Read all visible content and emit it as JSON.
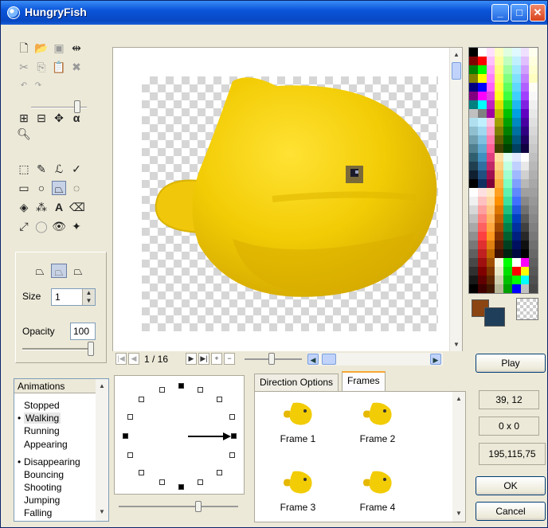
{
  "window": {
    "title": "HungryFish",
    "minimize_glyph": "_",
    "maximize_glyph": "□",
    "close_glyph": "✕"
  },
  "tools": {
    "icons": [
      "new-file-icon",
      "open-folder-icon",
      "save-icon",
      "resize-icon",
      "cut-icon",
      "copy-icon",
      "paste-icon",
      "delete-icon",
      "undo-icon",
      "redo-icon",
      "grid-icon",
      "frame-grid-icon",
      "move-icon",
      "alpha-icon",
      "zoom-icon",
      "select-rect-icon",
      "pencil-icon",
      "brush-icon",
      "picker-icon",
      "rectangle-icon",
      "ellipse-icon",
      "polygon-icon",
      "lasso-icon",
      "fill-icon",
      "spray-icon",
      "text-icon",
      "eraser-icon",
      "line-icon",
      "circle-select-icon",
      "eye-icon",
      "move-arrow-icon"
    ]
  },
  "options": {
    "size_label": "Size",
    "size_value": "1",
    "opacity_label": "Opacity",
    "opacity_value": "100"
  },
  "frame_nav": {
    "counter": "1 / 16"
  },
  "palette": {
    "columns": [
      [
        "#000000",
        "#800000",
        "#008000",
        "#808000",
        "#000080",
        "#800080",
        "#008080",
        "#c0c0c0",
        "#b0e0f0",
        "#90c0d0",
        "#70a0b0",
        "#508090",
        "#306070",
        "#204050",
        "#102030",
        "#000000",
        "#ffffff",
        "#f0f0f0",
        "#d8d8d8",
        "#c0c0c0",
        "#a8a8a8",
        "#909090",
        "#787878",
        "#606060",
        "#484848",
        "#303030",
        "#181818",
        "#000000"
      ],
      [
        "#ffffff",
        "#ff0000",
        "#00ff00",
        "#ffff00",
        "#0000ff",
        "#ff00ff",
        "#00ffff",
        "#808080",
        "#c0f0ff",
        "#a0d8f0",
        "#80c0e0",
        "#60a8d0",
        "#4090c0",
        "#3070a0",
        "#205080",
        "#103060",
        "#ffe0e0",
        "#ffc0c0",
        "#ffa0a0",
        "#ff8080",
        "#ff6060",
        "#ff4040",
        "#e03030",
        "#c02020",
        "#a01010",
        "#800000",
        "#600000",
        "#400000"
      ],
      [
        "#ffe0ff",
        "#ffc0ff",
        "#ffa0ff",
        "#ff80ff",
        "#ff60ff",
        "#e040e0",
        "#c020c0",
        "#a000a0",
        "#ffc0e0",
        "#ffa0c8",
        "#ff80b0",
        "#ff6098",
        "#e04080",
        "#c02868",
        "#a01050",
        "#800038",
        "#ffe8c0",
        "#ffd8a0",
        "#ffc880",
        "#ffb860",
        "#ffa840",
        "#ff9820",
        "#e08010",
        "#c06800",
        "#a05000",
        "#803800",
        "#602800",
        "#401800"
      ],
      [
        "#ffffc0",
        "#ffffa0",
        "#ffff80",
        "#ffff60",
        "#ffff40",
        "#ffff20",
        "#e0e000",
        "#c0c000",
        "#a0a000",
        "#808000",
        "#606000",
        "#404000",
        "#ffe0a0",
        "#ffd080",
        "#ffc060",
        "#ffb040",
        "#ffa020",
        "#ff9000",
        "#e07800",
        "#c06000",
        "#a04800",
        "#803000",
        "#602000",
        "#401000",
        "#f8f8e0",
        "#e8e8c8",
        "#d0d0b0",
        "#b8b898"
      ],
      [
        "#e0ffe0",
        "#c0ffc0",
        "#a0ffa0",
        "#80ff80",
        "#60ff60",
        "#40ff40",
        "#20e020",
        "#00c000",
        "#00a000",
        "#008000",
        "#006000",
        "#004000",
        "#e0fff0",
        "#c0ffe0",
        "#a0ffd0",
        "#80ffc0",
        "#60f0b0",
        "#40e0a0",
        "#20c080",
        "#00a060",
        "#008048",
        "#006030",
        "#004020",
        "#002010",
        "#00ff00",
        "#00e000",
        "#00c000",
        "#00a000"
      ],
      [
        "#e0f8ff",
        "#c0f0ff",
        "#a0e8ff",
        "#80e0ff",
        "#60d8ff",
        "#40d0ff",
        "#20b8f0",
        "#00a0e0",
        "#0088c0",
        "#0070a0",
        "#005880",
        "#004060",
        "#e0e8ff",
        "#c0d0ff",
        "#a0b8ff",
        "#80a0ff",
        "#6088ff",
        "#4070ff",
        "#2058e0",
        "#0040c0",
        "#0030a0",
        "#002080",
        "#001060",
        "#000840",
        "#ffffff",
        "#ff0000",
        "#00ff00",
        "#0000ff"
      ],
      [
        "#f0e0ff",
        "#e0c0ff",
        "#d0a0ff",
        "#c080ff",
        "#b060ff",
        "#a040ff",
        "#8020e0",
        "#6000c0",
        "#4800a0",
        "#300080",
        "#200060",
        "#100040",
        "#ffffff",
        "#e8e8e8",
        "#d0d0d0",
        "#b8b8b8",
        "#a0a0a0",
        "#888888",
        "#707070",
        "#585858",
        "#404040",
        "#282828",
        "#101010",
        "#000000",
        "#ff00ff",
        "#ffff00",
        "#00ffff",
        "#c0c0c0"
      ],
      [
        "#fffff0",
        "#ffffe0",
        "#ffffd0",
        "#ffffc0",
        "#fffff8",
        "#f8f8f8",
        "#f0f0f0",
        "#e8e8e8",
        "#e0e0e0",
        "#d8d8d8",
        "#d0d0d0",
        "#c8c8c8",
        "#c0c0c0",
        "#b8b8b8",
        "#b0b0b0",
        "#a8a8a8",
        "#a0a0a0",
        "#989898",
        "#909090",
        "#888888",
        "#808080",
        "#787878",
        "#707070",
        "#686868",
        "#606060",
        "#585858",
        "#505050",
        "#484848"
      ]
    ],
    "fg_color": "#8b4513",
    "bg_color": "#1f3e5a"
  },
  "buttons": {
    "play": "Play",
    "ok": "OK",
    "cancel": "Cancel"
  },
  "status": {
    "coords": "39, 12",
    "selection": "0 x 0",
    "color": "195,115,75"
  },
  "animations": {
    "header": "Animations",
    "items": [
      {
        "label": "Stopped",
        "bullet": ""
      },
      {
        "label": "Walking",
        "bullet": "•",
        "selected": true
      },
      {
        "label": "Running",
        "bullet": ""
      },
      {
        "label": "Appearing",
        "bullet": ""
      },
      {
        "label": "Disappearing",
        "bullet": "•"
      },
      {
        "label": "Bouncing",
        "bullet": ""
      },
      {
        "label": "Shooting",
        "bullet": ""
      },
      {
        "label": "Jumping",
        "bullet": ""
      },
      {
        "label": "Falling",
        "bullet": ""
      }
    ]
  },
  "tabs": {
    "direction": "Direction Options",
    "frames": "Frames"
  },
  "frames": [
    {
      "label": "Frame 1"
    },
    {
      "label": "Frame 2"
    },
    {
      "label": "Frame 3"
    },
    {
      "label": "Frame 4"
    }
  ]
}
